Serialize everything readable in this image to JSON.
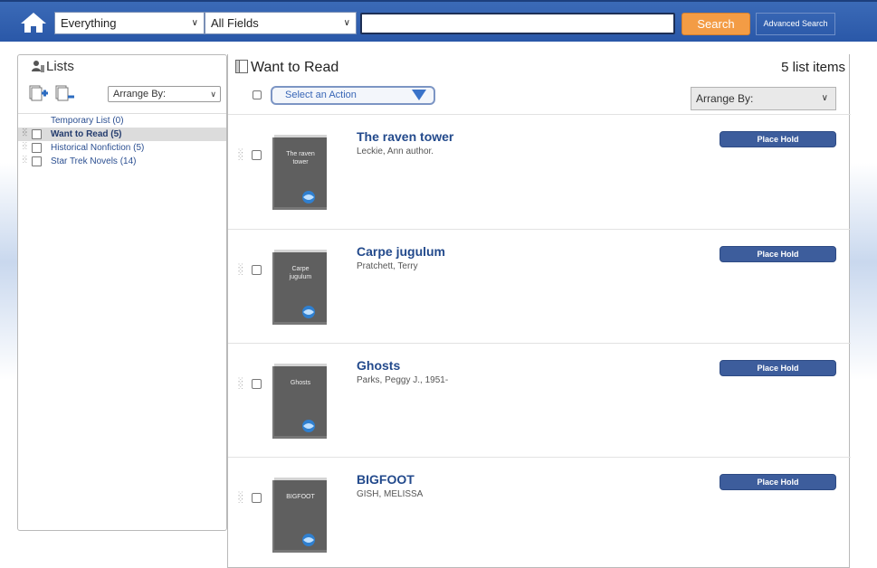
{
  "header": {
    "home_icon": "home-icon",
    "scope_select": "Everything",
    "field_select": "All Fields",
    "search_value": "",
    "search_button": "Search",
    "advanced_search": "Advanced Search"
  },
  "sidebar": {
    "title": "Lists",
    "arrange_by": "Arrange By:",
    "items": [
      {
        "label": "Temporary List (0)"
      },
      {
        "label": "Want to Read (5)"
      },
      {
        "label": "Historical Nonfiction (5)"
      },
      {
        "label": "Star Trek Novels (14)"
      }
    ]
  },
  "main": {
    "list_title": "Want to Read",
    "count": "5 list items",
    "action_select": "Select an Action",
    "arrange_by": "Arrange By:",
    "items": [
      {
        "title": "The raven tower",
        "author": "Leckie, Ann author.",
        "cover_text": "The raven tower",
        "hold": "Place Hold"
      },
      {
        "title": "Carpe jugulum",
        "author": "Pratchett, Terry",
        "cover_text": "Carpe jugulum",
        "hold": "Place Hold"
      },
      {
        "title": "Ghosts",
        "author": "Parks, Peggy J., 1951-",
        "cover_text": "Ghosts",
        "hold": "Place Hold"
      },
      {
        "title": "BIGFOOT",
        "author": "GISH, MELISSA",
        "cover_text": "BIGFOOT",
        "hold": "Place Hold"
      }
    ]
  },
  "colors": {
    "topbar": "#2a58a8",
    "search_button": "#f39c45",
    "hold_button": "#3d5d9c",
    "link": "#234a8c"
  }
}
